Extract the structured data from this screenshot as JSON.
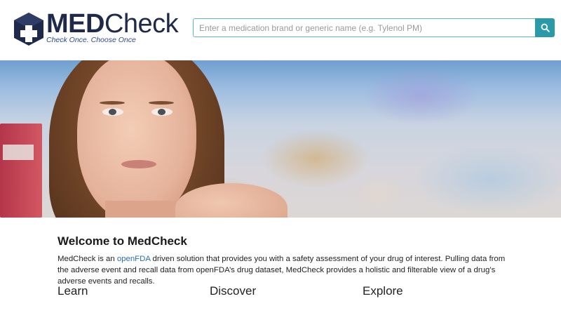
{
  "header": {
    "logo": {
      "brand_bold": "MED",
      "brand_regular": "Check",
      "tagline": "Check Once. Choose Once",
      "icon": "medical-cross-cube-icon"
    },
    "search": {
      "placeholder": "Enter a medication brand or generic name (e.g. Tylenol PM)",
      "value": "",
      "button_icon": "search-icon"
    }
  },
  "hero": {
    "image": "woman-in-pharmacy-photo"
  },
  "intro": {
    "title": "Welcome to MedCheck",
    "text_before_link": "MedCheck is an ",
    "link_text": "openFDA",
    "text_after_link": " driven solution that provides you with a safety assessment of your drug of interest. Pulling data from the adverse event and recall data from openFDA’s drug dataset, MedCheck provides a holistic and filterable view of a drug’s adverse events and recalls."
  },
  "sections": [
    {
      "heading": "Learn"
    },
    {
      "heading": "Discover"
    },
    {
      "heading": "Explore"
    }
  ],
  "colors": {
    "brand_navy": "#1f2a4b",
    "tagline_blue": "#2b4a8b",
    "search_button": "#2a9aa8",
    "link_blue": "#2a6cb5"
  }
}
